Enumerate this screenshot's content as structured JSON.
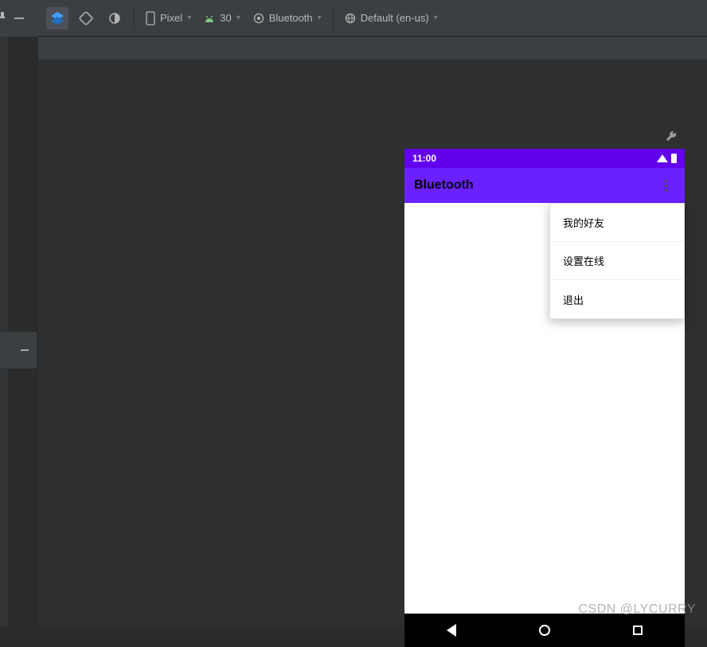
{
  "toolbar": {
    "device_label": "Pixel",
    "api_label": "30",
    "feature_label": "Bluetooth",
    "locale_label": "Default (en-us)"
  },
  "preview": {
    "statusbar": {
      "time": "11:00"
    },
    "appbar": {
      "title": "Bluetooth"
    },
    "menu": {
      "items": [
        {
          "label": "我的好友"
        },
        {
          "label": "设置在线"
        },
        {
          "label": "退出"
        }
      ]
    }
  },
  "watermark": "CSDN @LYCURRY",
  "colors": {
    "accent": "#6200ee",
    "appbar": "#6b21ff"
  }
}
